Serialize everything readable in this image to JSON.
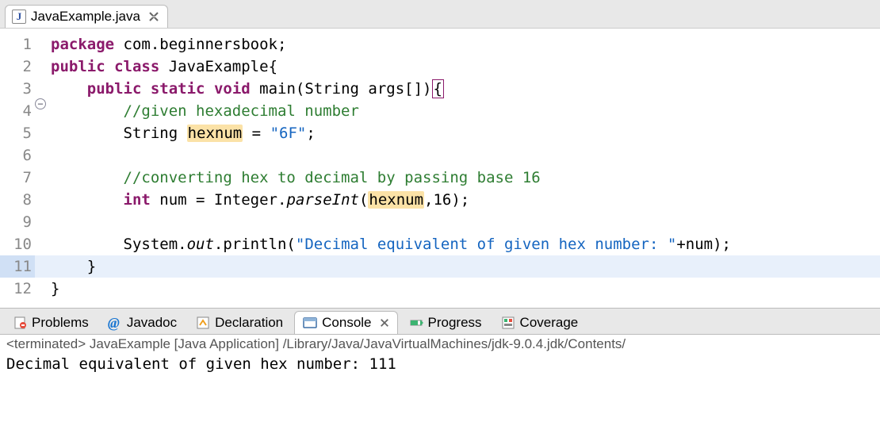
{
  "editor": {
    "tab_label": "JavaExample.java",
    "lines": [
      {
        "n": "1",
        "content": [
          [
            "kw",
            "package"
          ],
          [
            "",
            " com.beginnersbook;"
          ]
        ]
      },
      {
        "n": "2",
        "content": [
          [
            "kw",
            "public"
          ],
          [
            "",
            " "
          ],
          [
            "kw",
            "class"
          ],
          [
            "",
            " JavaExample{"
          ]
        ]
      },
      {
        "n": "3",
        "fold": true,
        "content": [
          [
            "",
            "    "
          ],
          [
            "kw",
            "public"
          ],
          [
            "",
            " "
          ],
          [
            "kw",
            "static"
          ],
          [
            "",
            " "
          ],
          [
            "kw",
            "void"
          ],
          [
            "",
            " main(String args[])"
          ],
          [
            "brace",
            "{"
          ]
        ]
      },
      {
        "n": "4",
        "content": [
          [
            "",
            "        "
          ],
          [
            "cm",
            "//given hexadecimal number"
          ]
        ]
      },
      {
        "n": "5",
        "content": [
          [
            "",
            "        String "
          ],
          [
            "hl",
            "hexnum"
          ],
          [
            "",
            " = "
          ],
          [
            "str",
            "\"6F\""
          ],
          [
            "",
            ";"
          ]
        ]
      },
      {
        "n": "6",
        "content": []
      },
      {
        "n": "7",
        "content": [
          [
            "",
            "        "
          ],
          [
            "cm",
            "//converting hex to decimal by passing base 16"
          ]
        ]
      },
      {
        "n": "8",
        "content": [
          [
            "",
            "        "
          ],
          [
            "kw",
            "int"
          ],
          [
            "",
            " num = Integer."
          ],
          [
            "itlc",
            "parseInt"
          ],
          [
            "",
            "("
          ],
          [
            "hl",
            "hexnum"
          ],
          [
            "",
            ",16);"
          ]
        ]
      },
      {
        "n": "9",
        "content": []
      },
      {
        "n": "10",
        "content": [
          [
            "",
            "        System."
          ],
          [
            "itlc",
            "out"
          ],
          [
            "",
            ".println("
          ],
          [
            "str",
            "\"Decimal equivalent of given hex number: \""
          ],
          [
            "",
            "+num);"
          ]
        ]
      },
      {
        "n": "11",
        "hl": true,
        "content": [
          [
            "",
            "    }"
          ]
        ]
      },
      {
        "n": "12",
        "content": [
          [
            "",
            "}"
          ]
        ]
      }
    ]
  },
  "bottom_tabs": {
    "problems": "Problems",
    "javadoc": "Javadoc",
    "declaration": "Declaration",
    "console": "Console",
    "progress": "Progress",
    "coverage": "Coverage"
  },
  "console": {
    "status": "<terminated> JavaExample [Java Application] /Library/Java/JavaVirtualMachines/jdk-9.0.4.jdk/Contents/",
    "output": "Decimal equivalent of given hex number: 111"
  },
  "colors": {
    "keyword": "#8b1a6b",
    "comment": "#2e7d32",
    "string": "#1565c0",
    "highlight": "#fbe2a7"
  }
}
